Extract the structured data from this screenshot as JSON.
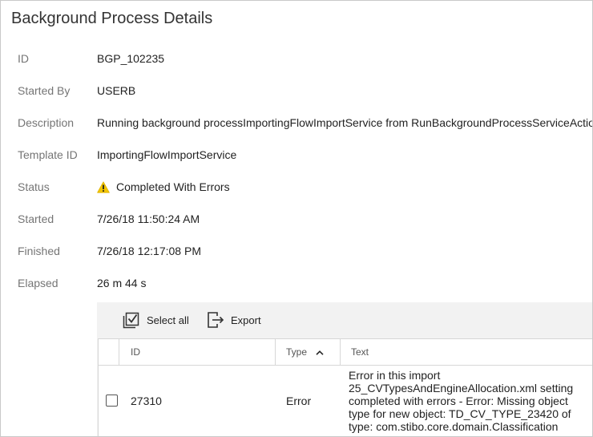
{
  "page": {
    "title": "Background Process Details"
  },
  "details": [
    {
      "label": "ID",
      "value": "BGP_102235"
    },
    {
      "label": "Started By",
      "value": "USERB"
    },
    {
      "label": "Description",
      "value": "Running background processImportingFlowImportService from RunBackgroundProcessServiceAction"
    },
    {
      "label": "Template ID",
      "value": "ImportingFlowImportService"
    },
    {
      "label": "Status",
      "value": "Completed With Errors",
      "icon": "warning-icon",
      "icon_color": "#f2c500"
    },
    {
      "label": "Started",
      "value": "7/26/18 11:50:24 AM"
    },
    {
      "label": "Finished",
      "value": "7/26/18 12:17:08 PM"
    },
    {
      "label": "Elapsed",
      "value": "26 m 44 s"
    }
  ],
  "toolbar": {
    "select_all_label": "Select all",
    "select_all_icon": "select-all-icon",
    "export_label": "Export",
    "export_icon": "export-icon"
  },
  "table": {
    "columns": [
      {
        "key": "id",
        "label": "ID"
      },
      {
        "key": "type",
        "label": "Type",
        "sort": "ascending"
      },
      {
        "key": "text",
        "label": "Text"
      }
    ],
    "rows": [
      {
        "checked": false,
        "id": "27310",
        "type": "Error",
        "text": "Error in this import 25_CVTypesAndEngineAllocation.xml setting completed with errors - Error: Missing object type for new object: TD_CV_TYPE_23420 of type: com.stibo.core.domain.Classification"
      }
    ]
  },
  "colors": {
    "label_text": "#757575",
    "panel_background": "#f2f2f2",
    "border": "#d7d7d7",
    "warning": "#f2c500"
  }
}
